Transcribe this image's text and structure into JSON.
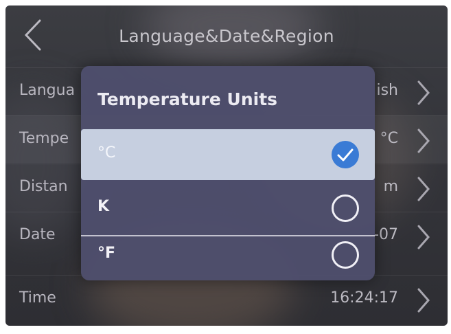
{
  "header": {
    "title": "Language&Date&Region"
  },
  "settings": [
    {
      "label": "Langua",
      "value": "ish"
    },
    {
      "label": "Tempe",
      "value": "°C"
    },
    {
      "label": "Distan",
      "value": "m"
    },
    {
      "label": "Date",
      "value": "-07"
    },
    {
      "label": "Time",
      "value": "16:24:17"
    }
  ],
  "dialog": {
    "title": "Temperature Units",
    "options": [
      {
        "label": "°C",
        "selected": true
      },
      {
        "label": "K",
        "selected": false
      },
      {
        "label": "°F",
        "selected": false
      }
    ]
  },
  "colors": {
    "accent": "#3a7bd5",
    "dialog_bg": "#4e4e6c",
    "selected_row": "#c6cfe0"
  }
}
